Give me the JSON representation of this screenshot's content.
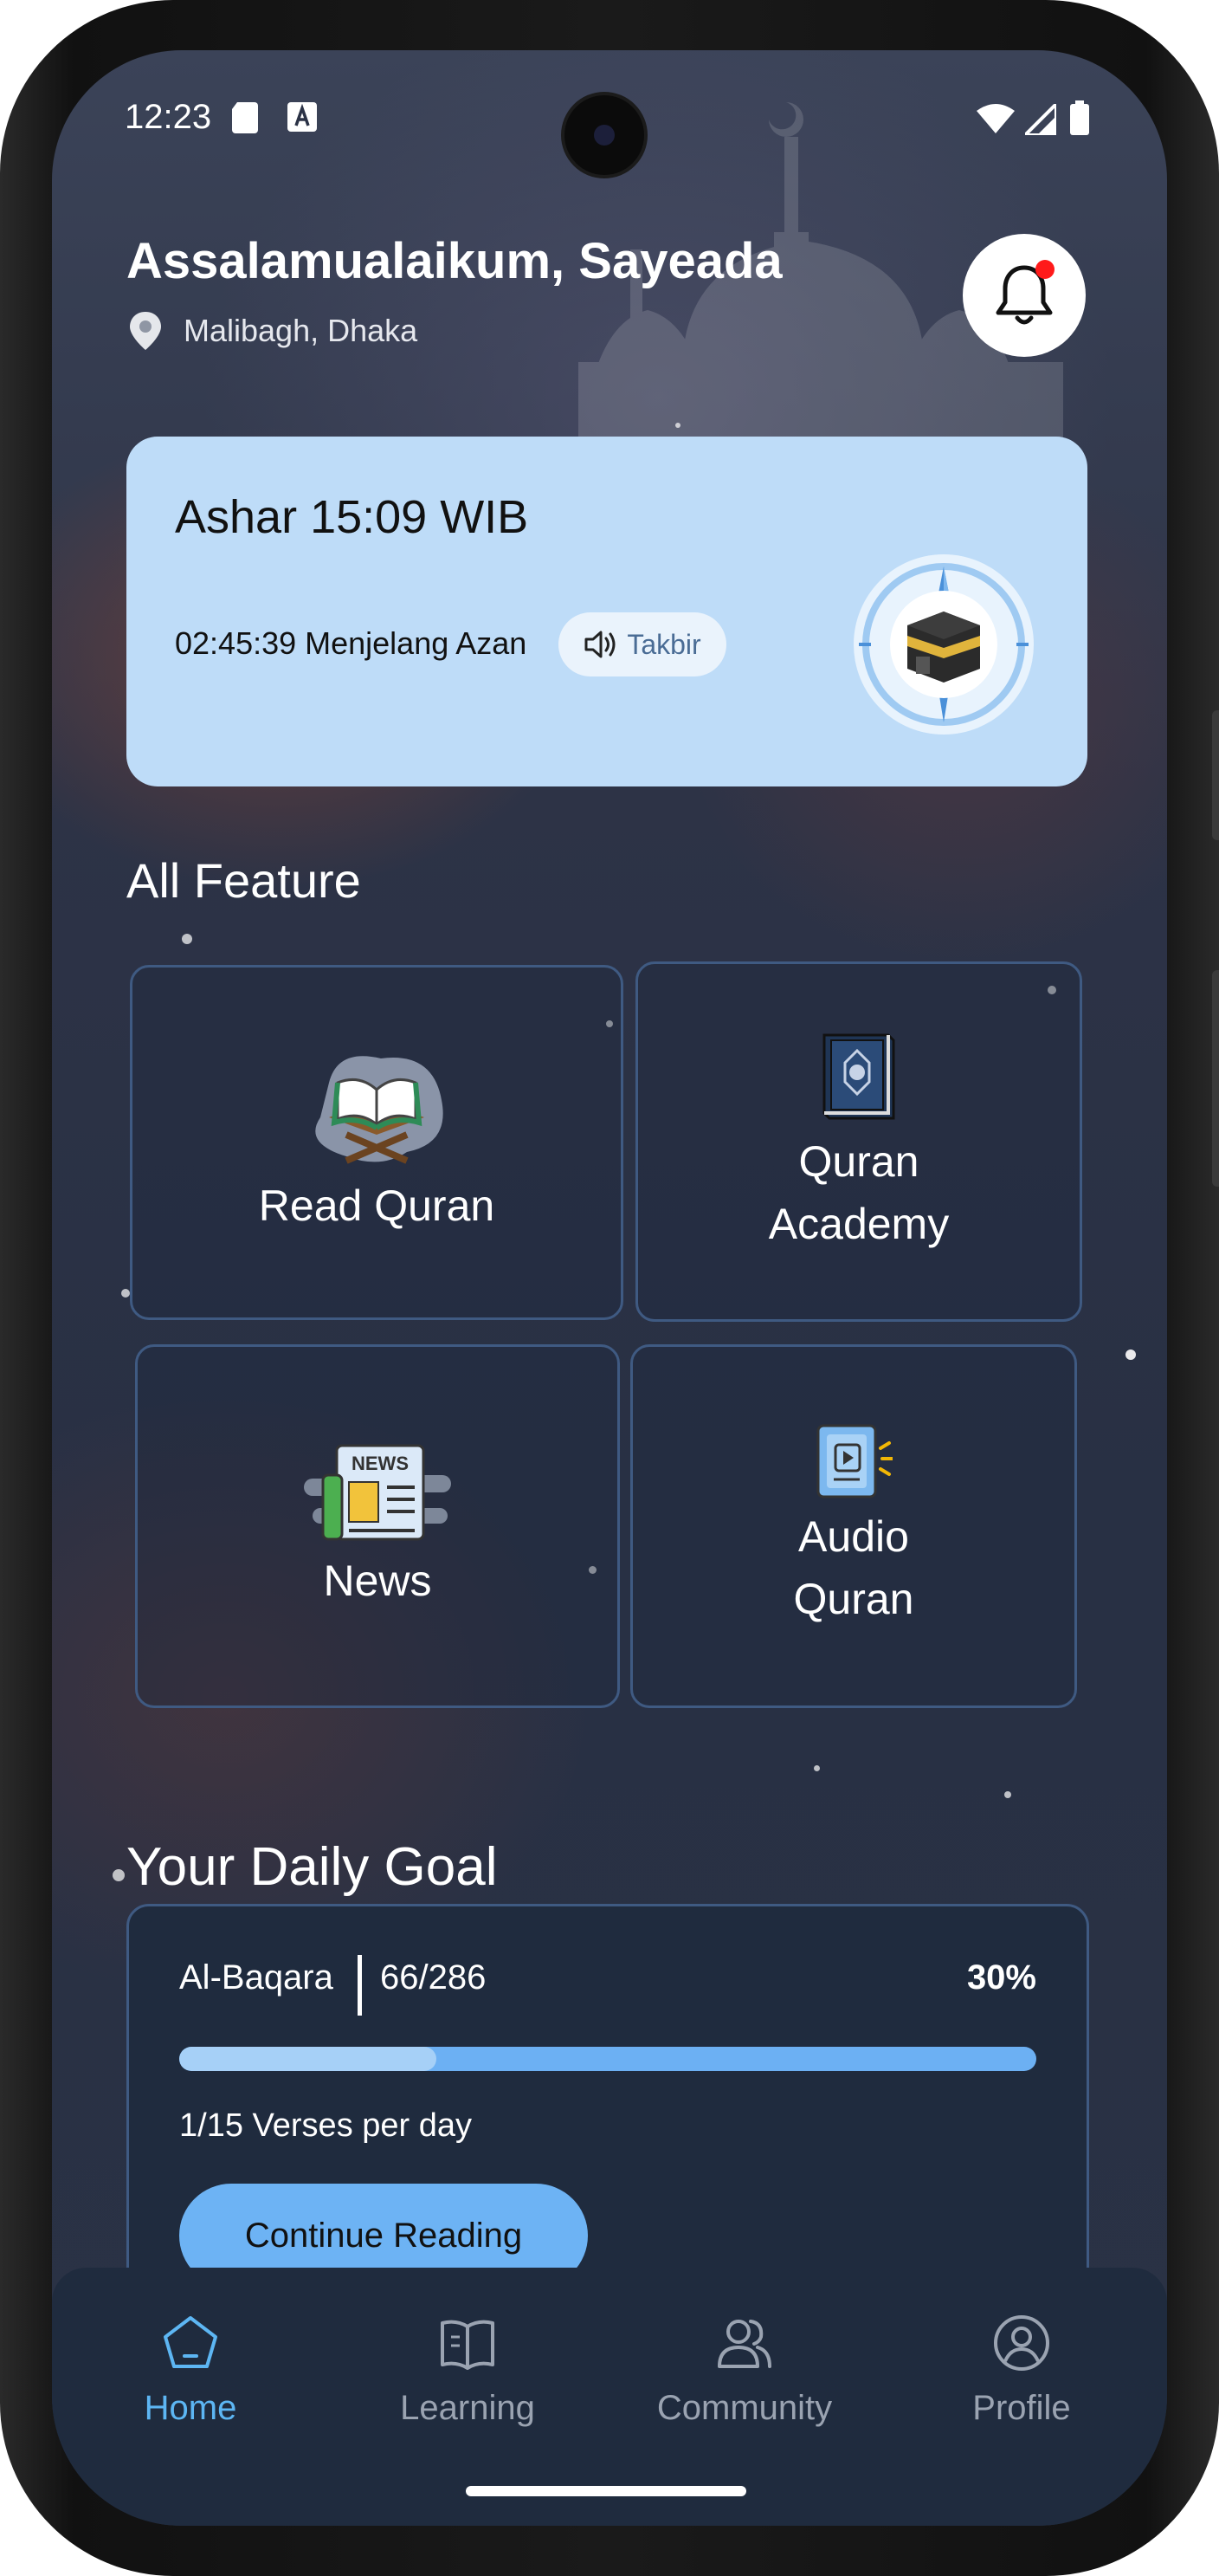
{
  "status_bar": {
    "time": "12:23"
  },
  "header": {
    "greeting": "Assalamualaikum, Sayeada",
    "location": "Malibagh, Dhaka"
  },
  "prayer_card": {
    "title": "Ashar 15:09 WIB",
    "countdown": "02:45:39 Menjelang Azan",
    "takbir_label": "Takbir"
  },
  "features": {
    "title": "All Feature",
    "items": [
      {
        "line1": "Read Quran",
        "line2": "",
        "icon": "quran-stand-icon"
      },
      {
        "line1": "Quran",
        "line2": "Academy",
        "icon": "quran-book-icon"
      },
      {
        "line1": "News",
        "line2": "",
        "icon": "newspaper-icon"
      },
      {
        "line1": "Audio",
        "line2": "Quran",
        "icon": "audio-book-icon"
      }
    ]
  },
  "daily_goal": {
    "title": "Your Daily Goal",
    "surah": "Al-Baqara",
    "progress_text": "66/286",
    "percent_text": "30%",
    "progress_fraction": 0.3,
    "verses_per_day": "1/15 Verses per day",
    "continue_label": "Continue Reading"
  },
  "nav": [
    {
      "label": "Home",
      "icon": "home-icon",
      "active": true
    },
    {
      "label": "Learning",
      "icon": "book-open-icon",
      "active": false
    },
    {
      "label": "Community",
      "icon": "users-icon",
      "active": false
    },
    {
      "label": "Profile",
      "icon": "user-circle-icon",
      "active": false
    }
  ],
  "colors": {
    "accent": "#5db6f3",
    "prayer_card_bg": "#bedcf8",
    "card_border": "#3f5a82",
    "nav_bg": "#1f2b3e",
    "notification_dot": "#ff1a1a"
  }
}
